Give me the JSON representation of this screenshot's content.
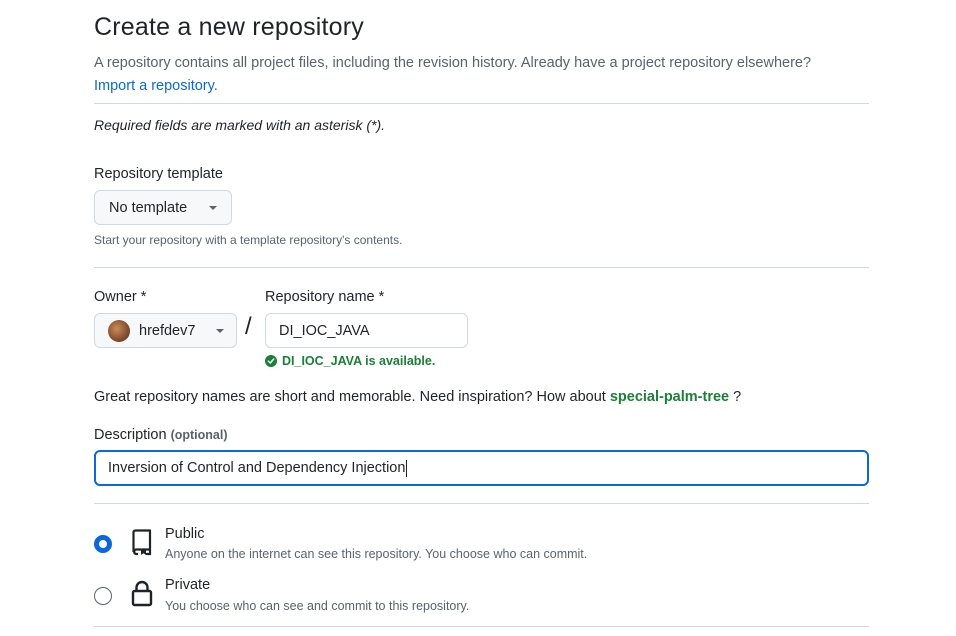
{
  "header": {
    "title": "Create a new repository",
    "subtitle": "A repository contains all project files, including the revision history. Already have a project repository elsewhere?",
    "import_link": "Import a repository."
  },
  "required_note": "Required fields are marked with an asterisk (*).",
  "template": {
    "label": "Repository template",
    "selected": "No template",
    "hint": "Start your repository with a template repository's contents."
  },
  "owner": {
    "label": "Owner *",
    "selected": "hrefdev7"
  },
  "separator": "/",
  "repo_name": {
    "label": "Repository name *",
    "value": "DI_IOC_JAVA",
    "availability": "DI_IOC_JAVA is available."
  },
  "inspiration": {
    "text": "Great repository names are short and memorable. Need inspiration? How about",
    "suggestion": "special-palm-tree",
    "suffix": "?"
  },
  "description": {
    "label": "Description",
    "optional": "(optional)",
    "value": "Inversion of Control and Dependency Injection"
  },
  "visibility": [
    {
      "title": "Public",
      "description": "Anyone on the internet can see this repository. You choose who can commit.",
      "icon": "repo-icon",
      "selected": true
    },
    {
      "title": "Private",
      "description": "You choose who can see and commit to this repository.",
      "icon": "lock-icon",
      "selected": false
    }
  ],
  "colors": {
    "accent": "#0969da",
    "success": "#1a7f37",
    "muted_text": "#59636e",
    "border": "#d1d9e0"
  }
}
